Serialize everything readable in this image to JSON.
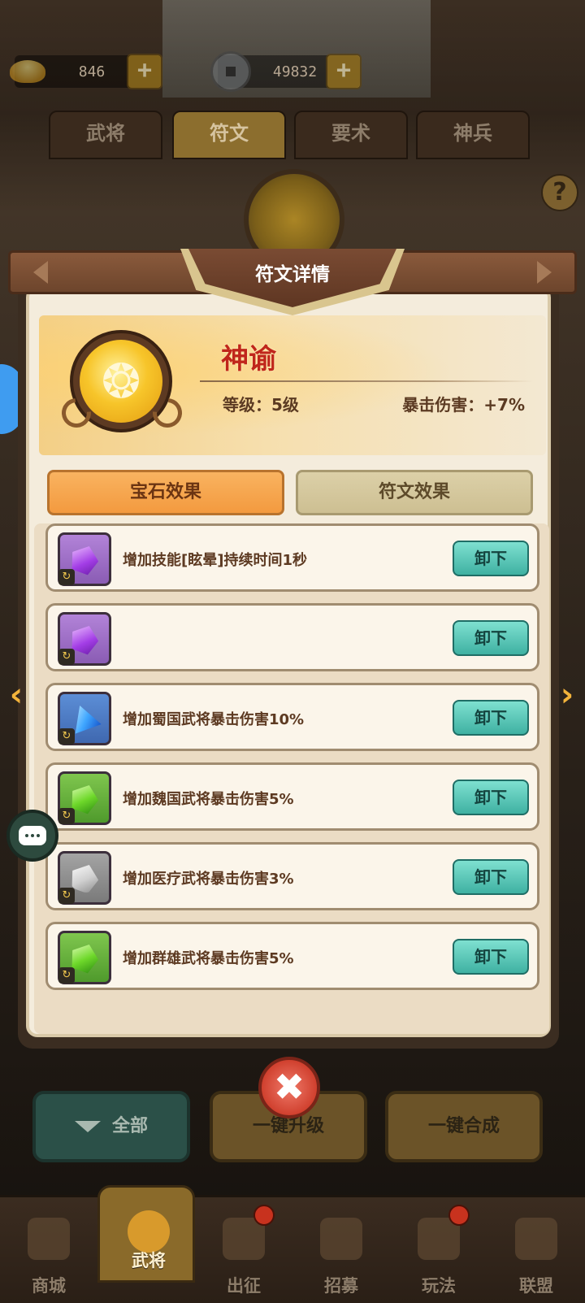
{
  "currency": {
    "gold": {
      "value": "846",
      "plus": "+"
    },
    "coin": {
      "value": "49832",
      "plus": "+"
    }
  },
  "tabs": [
    "武将",
    "符文",
    "要术",
    "神兵"
  ],
  "active_tab": "符文",
  "help": "?",
  "modal": {
    "title": "符文详情",
    "rune": {
      "name": "神谕",
      "level": "等级：5级",
      "crit": "暴击伤害：+7%"
    },
    "effect_tabs": {
      "gem": "宝石效果",
      "rune": "符文效果"
    },
    "gems": [
      {
        "color": "purple",
        "desc": "增加技能[眩晕]持续时间1秒",
        "button": "卸下"
      },
      {
        "color": "purple",
        "desc": "",
        "button": "卸下"
      },
      {
        "color": "blue",
        "desc": "增加蜀国武将暴击伤害10%",
        "button": "卸下"
      },
      {
        "color": "green",
        "desc": "增加魏国武将暴击伤害5%",
        "button": "卸下"
      },
      {
        "color": "gray",
        "desc": "增加医疗武将暴击伤害3%",
        "button": "卸下"
      },
      {
        "color": "green",
        "desc": "增加群雄武将暴击伤害5%",
        "button": "卸下"
      }
    ]
  },
  "bottom_buttons": {
    "all": "全部",
    "upgrade": "一键升级",
    "compose": "一键合成"
  },
  "nav": [
    {
      "label": "商城",
      "badge": false
    },
    {
      "label": "武将",
      "badge": false,
      "active": true
    },
    {
      "label": "出征",
      "badge": true
    },
    {
      "label": "招募",
      "badge": false
    },
    {
      "label": "玩法",
      "badge": true
    },
    {
      "label": "联盟",
      "badge": false
    }
  ],
  "colors": {
    "accent_orange": "#f39a3f",
    "unload_teal": "#3fb1a2",
    "rune_name_red": "#c0261b"
  }
}
